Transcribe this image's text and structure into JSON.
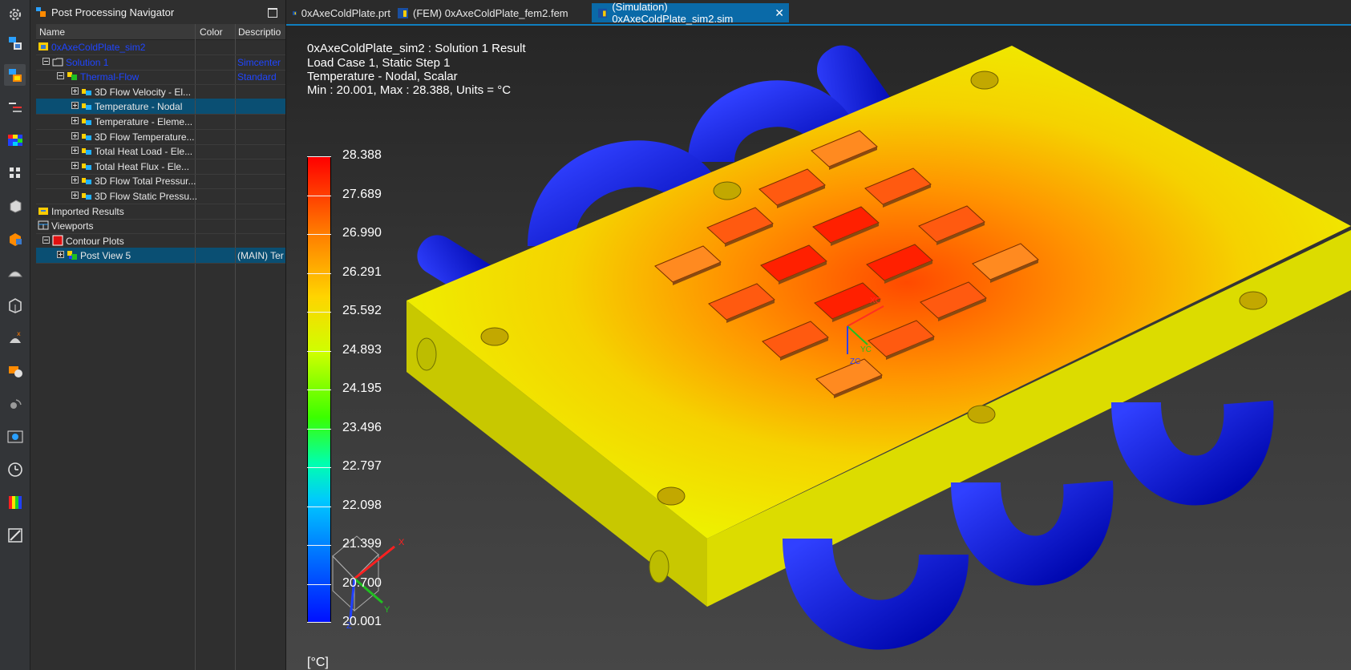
{
  "navigator": {
    "title": "Post Processing Navigator",
    "columns": [
      "Name",
      "Color",
      "Descriptio"
    ],
    "rows": [
      {
        "label": "0xAxeColdPlate_sim2",
        "desc": ""
      },
      {
        "label": "Solution 1",
        "desc": "Simcenter"
      },
      {
        "label": "Thermal-Flow",
        "desc": "Standard"
      },
      {
        "label": "3D Flow Velocity - El...",
        "desc": ""
      },
      {
        "label": "Temperature - Nodal",
        "desc": ""
      },
      {
        "label": "Temperature - Eleme...",
        "desc": ""
      },
      {
        "label": "3D Flow Temperature...",
        "desc": ""
      },
      {
        "label": "Total Heat Load - Ele...",
        "desc": ""
      },
      {
        "label": "Total Heat Flux - Ele...",
        "desc": ""
      },
      {
        "label": "3D Flow Total Pressur...",
        "desc": ""
      },
      {
        "label": "3D Flow Static Pressu...",
        "desc": ""
      },
      {
        "label": "Imported Results",
        "desc": ""
      },
      {
        "label": "Viewports",
        "desc": ""
      },
      {
        "label": "Contour Plots",
        "desc": ""
      },
      {
        "label": "Post View 5",
        "desc": "(MAIN) Ter"
      }
    ]
  },
  "tabs": [
    {
      "label": "0xAxeColdPlate.prt"
    },
    {
      "label": "(FEM) 0xAxeColdPlate_fem2.fem"
    },
    {
      "label": "(Simulation) 0xAxeColdPlate_sim2.sim",
      "active": true
    }
  ],
  "viewport": {
    "info": [
      "0xAxeColdPlate_sim2 : Solution 1 Result",
      "Load Case 1, Static Step 1",
      "Temperature - Nodal, Scalar",
      "Min : 20.001, Max : 28.388, Units = °C"
    ],
    "legend_labels": [
      "28.388",
      "27.689",
      "26.990",
      "26.291",
      "25.592",
      "24.893",
      "24.195",
      "23.496",
      "22.797",
      "22.098",
      "21.399",
      "20.700",
      "20.001"
    ],
    "units_label": "[°C]",
    "axes": {
      "x": "X",
      "y": "Y",
      "z": "Z",
      "xc": "XC",
      "yc": "YC",
      "zc": "ZC"
    }
  },
  "colors": {
    "selection": "#0a4f73",
    "tab_active": "#0a6aa8",
    "plate": "#f0f000",
    "pipe": "#0a14e0",
    "hot": "#ff1a00"
  },
  "icons": [
    "gear-icon",
    "navigator-icon",
    "post-navigator-icon",
    "results-icon",
    "contour-icon",
    "grid-icon",
    "part-icon",
    "fem-icon",
    "mesh-icon",
    "box-icon",
    "solver-icon",
    "tool-icon",
    "sensor-icon",
    "viewport-icon",
    "clock-icon",
    "colors-icon",
    "settings-icon"
  ]
}
